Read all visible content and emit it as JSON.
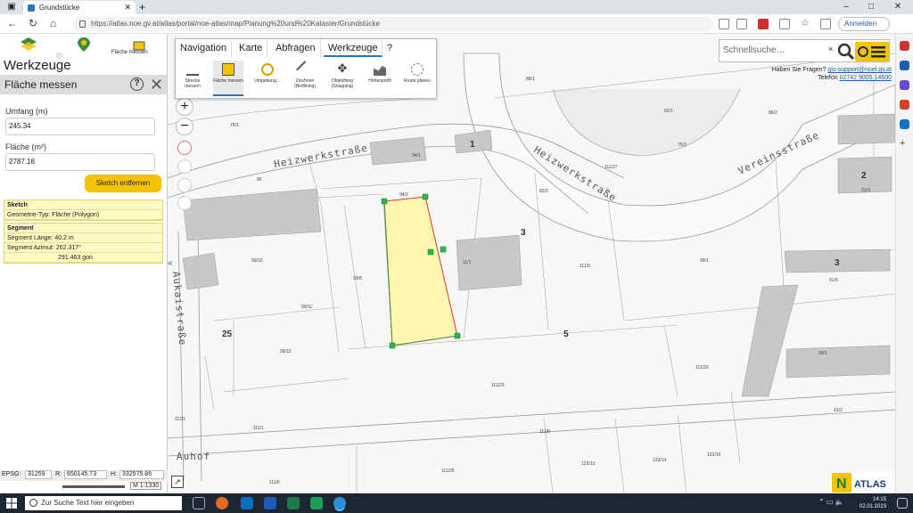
{
  "browser": {
    "tab_title": "Grundstücke",
    "url": "https://atlas.noe.gv.at/atlas/portal/noe-atlas/map/Planung%20und%20Kataster/Grundstücke",
    "signin_label": "Anmelden"
  },
  "sidebar": {
    "icon_caption": "Fläche messen",
    "title": "Werkzeuge",
    "panel_title": "Fläche messen",
    "perimeter_label": "Umfang (m)",
    "perimeter_value": "245.34",
    "area_label": "Fläche (m²)",
    "area_value": "2787.18",
    "remove_button": "Sketch entfernen",
    "sketch": {
      "header": "Sketch",
      "geometry_type": "Geometrie-Typ: Fläche (Polygon)"
    },
    "segment": {
      "header": "Segment",
      "length": "Segment Länge: 40.2 m",
      "azimuth": "Segment Azimut: 262.317°",
      "gon": "291.463 gon"
    },
    "coords": {
      "epsg_label": "EPSG:",
      "epsg_value": "31259",
      "r_label": "R:",
      "r_value": "650145.73",
      "h_label": "H:",
      "h_value": "332575.86",
      "scale": "M 1:1330"
    }
  },
  "toolbar": {
    "tabs": [
      "Navigation",
      "Karte",
      "Abfragen",
      "Werkzeuge",
      "?"
    ],
    "tools": [
      "Strecke messen",
      "Fläche messen",
      "Umgebung…",
      "Zeichnen (Redlining)",
      "Objektfang (Snapping)",
      "Höhenprofil",
      "Route planen"
    ]
  },
  "search": {
    "placeholder": "Schnellsuche…",
    "help_text": "Haben Sie Fragen?",
    "email": "gis-support@noel.gv.at",
    "phone_label": "Telefon",
    "phone": "02742 9005 14600"
  },
  "map": {
    "streets": [
      "Heizwerkstraße",
      "Heizwerkstraße",
      "Vereinsstraße",
      "Aukaistraße",
      "Auhof"
    ],
    "house_numbers": [
      "1",
      "2",
      "3",
      "3",
      "5",
      "25"
    ],
    "parcels": [
      "75/1",
      "94/1",
      "94/2",
      "86",
      "99/8",
      "99/10",
      "99/11",
      "99/12",
      "11/1",
      "111/9",
      "111/23",
      "82/1",
      "82/2",
      "75/2",
      "111/27",
      "99/1",
      "86/2",
      "91/3",
      "91/5",
      "99/1",
      "111/26",
      "123/13",
      "123/14",
      "123/16",
      "91/2",
      "111/1",
      "112/1",
      "111/6",
      "88/1",
      "111/29",
      "111/8"
    ],
    "logo_text": "ATLAS"
  },
  "taskbar": {
    "search_placeholder": "Zur Suche Text hier eingeben",
    "time": "14:15",
    "date": "02.01.2023"
  }
}
